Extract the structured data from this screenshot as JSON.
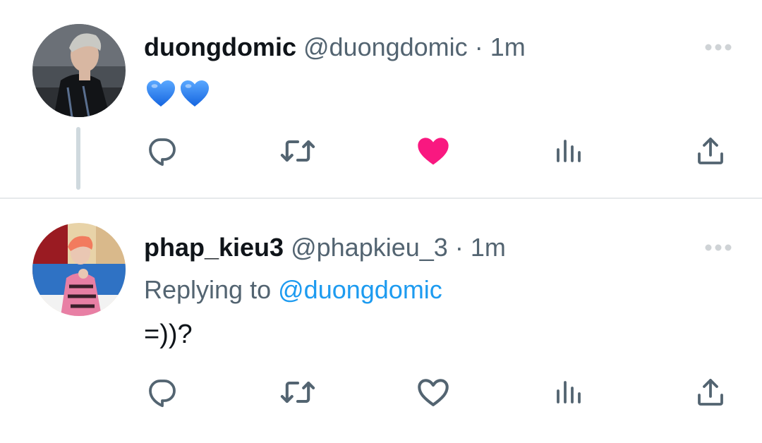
{
  "colors": {
    "text_primary": "#0f1419",
    "text_secondary": "#536471",
    "link": "#1d9bf0",
    "like_active": "#f91880",
    "icon": "#536471",
    "divider": "#e6e9eb",
    "thread_line": "#cfd9de"
  },
  "tweets": [
    {
      "author": {
        "display_name": "duongdomic",
        "handle": "@duongdomic"
      },
      "separator": "·",
      "time": "1m",
      "body_emojis": [
        "blue-heart-emoji",
        "blue-heart-emoji"
      ],
      "liked": true,
      "has_thread_line": true,
      "actions": [
        {
          "name": "reply",
          "icon": "speech-bubble-icon"
        },
        {
          "name": "retweet",
          "icon": "retweet-arrows-icon"
        },
        {
          "name": "like",
          "icon": "heart-filled-icon"
        },
        {
          "name": "views",
          "icon": "bar-chart-icon"
        },
        {
          "name": "share",
          "icon": "share-upload-icon"
        }
      ]
    },
    {
      "author": {
        "display_name": "phap_kieu3",
        "handle": "@phapkieu_3"
      },
      "separator": "·",
      "time": "1m",
      "replying_prefix": "Replying to",
      "replying_handle": "@duongdomic",
      "body_text": "=))?",
      "liked": false,
      "actions": [
        {
          "name": "reply",
          "icon": "speech-bubble-icon"
        },
        {
          "name": "retweet",
          "icon": "retweet-arrows-icon"
        },
        {
          "name": "like",
          "icon": "heart-outline-icon"
        },
        {
          "name": "views",
          "icon": "bar-chart-icon"
        },
        {
          "name": "share",
          "icon": "share-upload-icon"
        }
      ]
    }
  ]
}
